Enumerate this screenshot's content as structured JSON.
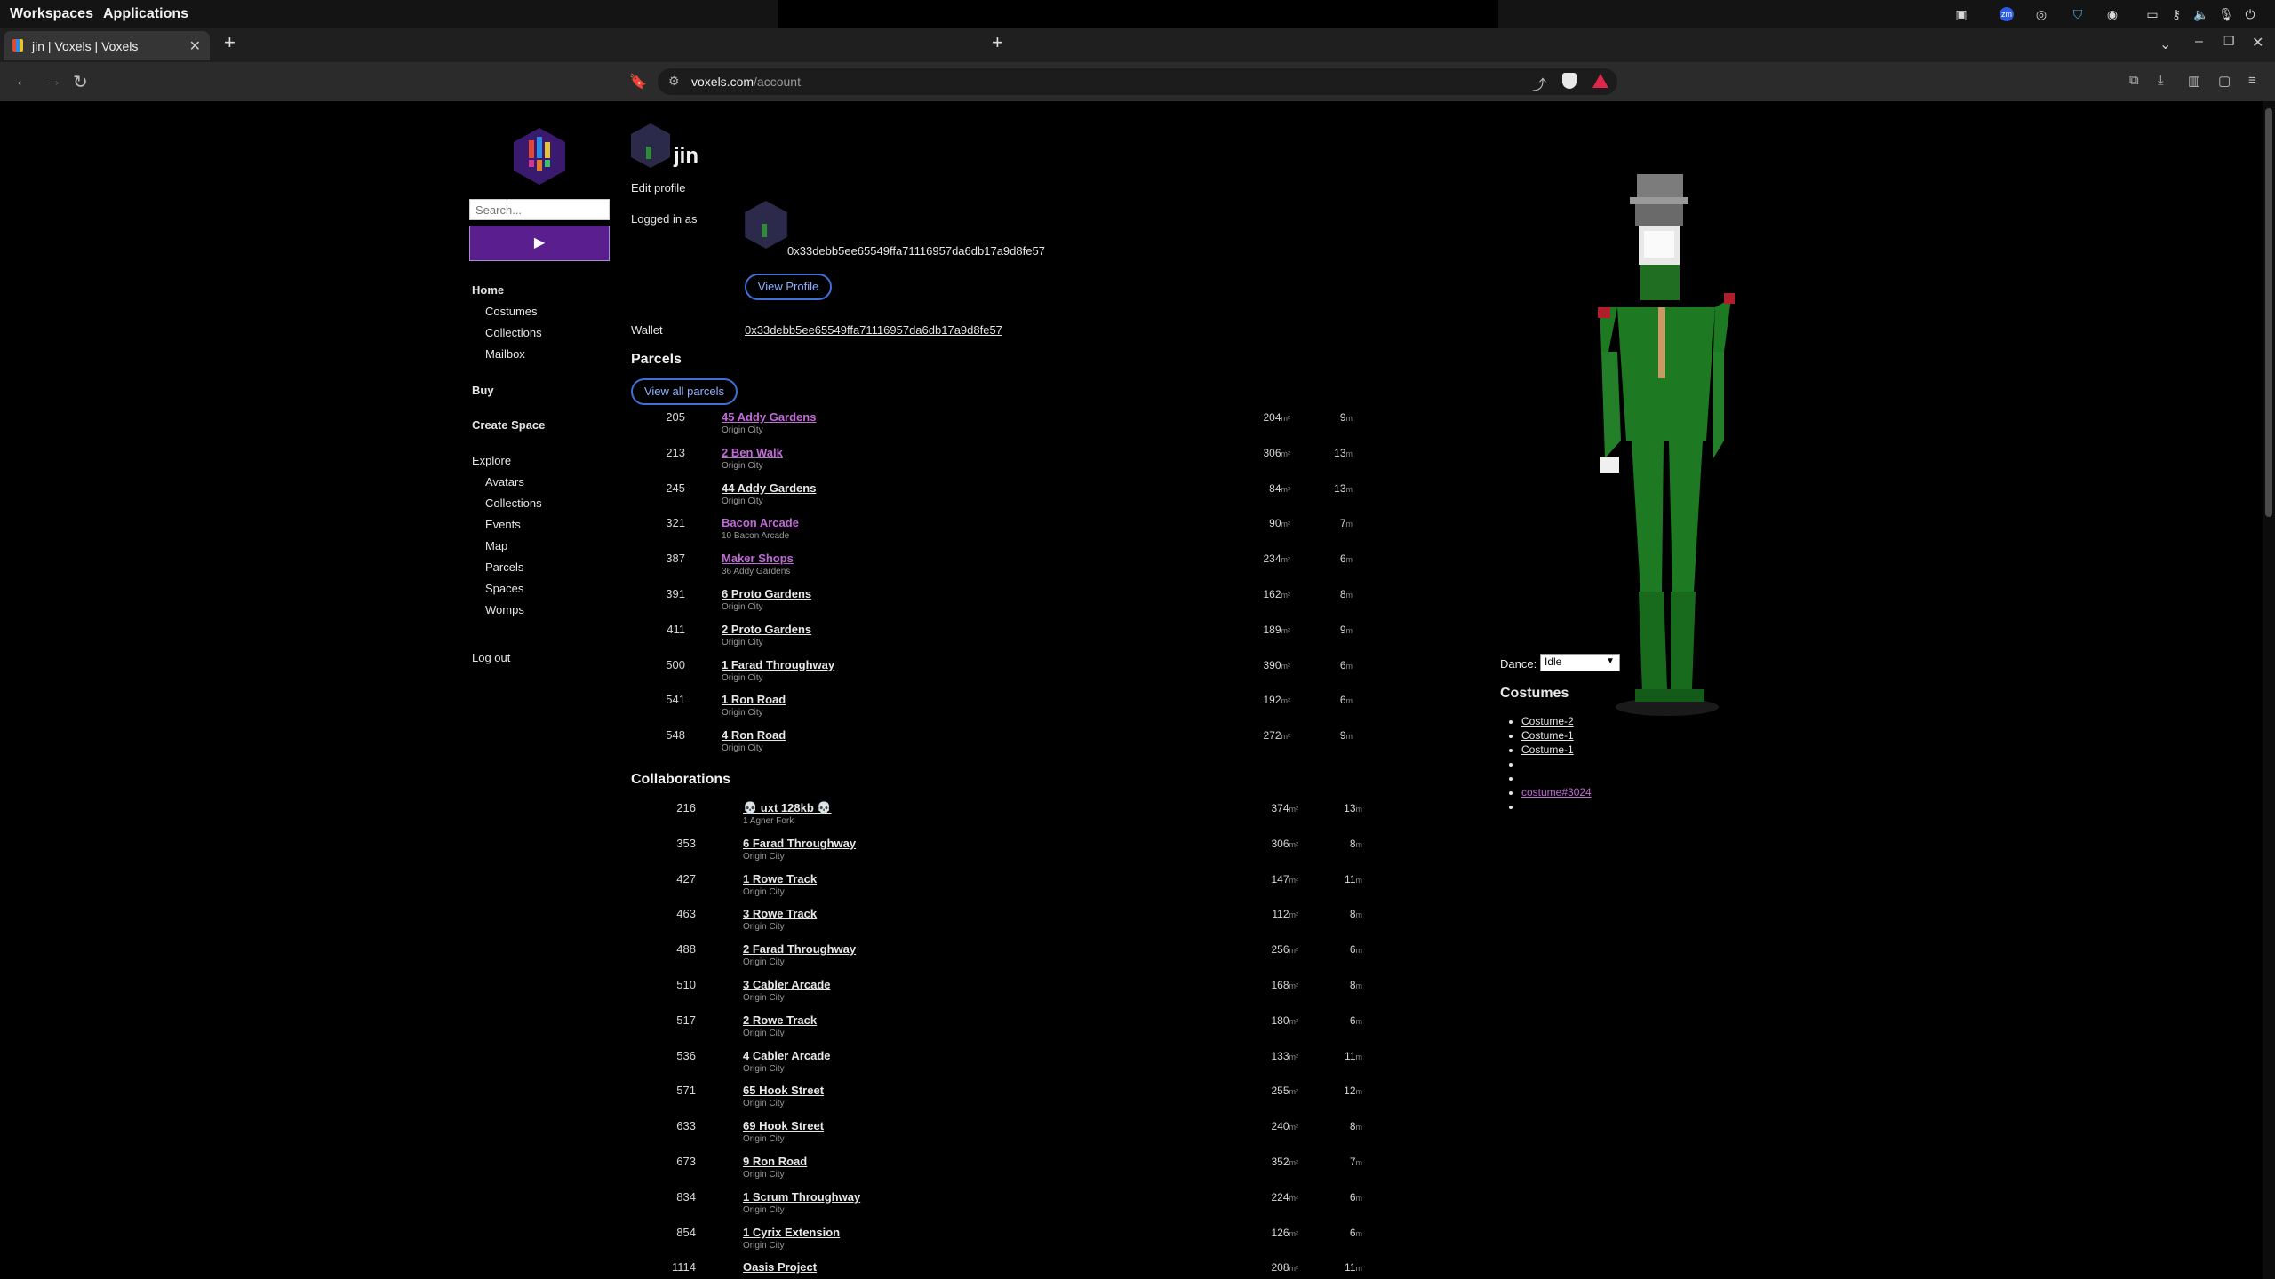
{
  "os_bar": {
    "workspaces": "Workspaces",
    "applications": "Applications",
    "tray_icons": [
      "dropbox-icon",
      "zoom-icon",
      "steam-icon",
      "vpn-icon",
      "discord-icon",
      "display-icon",
      "key-icon",
      "volume-icon",
      "mic-icon",
      "power-icon"
    ]
  },
  "browser": {
    "tab_title": "jin | Voxels | Voxels",
    "url_host": "voxels.com",
    "url_path": "/account"
  },
  "sidebar": {
    "search_placeholder": "Search...",
    "play_label": "▶",
    "home": "Home",
    "home_items": [
      "Costumes",
      "Collections",
      "Mailbox"
    ],
    "buy": "Buy",
    "create_space": "Create Space",
    "explore": "Explore",
    "explore_items": [
      "Avatars",
      "Collections",
      "Events",
      "Map",
      "Parcels",
      "Spaces",
      "Womps"
    ],
    "logout": "Log out"
  },
  "profile": {
    "name": "jin",
    "edit_profile": "Edit profile",
    "logged_in_as_label": "Logged in as",
    "address": "0x33debb5ee65549ffa71116957da6db17a9d8fe57",
    "view_profile": "View Profile",
    "wallet_label": "Wallet",
    "wallet_address": "0x33debb5ee65549ffa71116957da6db17a9d8fe57"
  },
  "parcels": {
    "heading": "Parcels",
    "view_all": "View all parcels",
    "area_unit": "m²",
    "height_unit": "m",
    "rows": [
      {
        "id": "205",
        "name": "45 Addy Gardens",
        "sub": "Origin City",
        "area": "204",
        "height": "9",
        "visited": true
      },
      {
        "id": "213",
        "name": "2 Ben Walk",
        "sub": "Origin City",
        "area": "306",
        "height": "13",
        "visited": true
      },
      {
        "id": "245",
        "name": "44 Addy Gardens",
        "sub": "Origin City",
        "area": "84",
        "height": "13",
        "visited": false
      },
      {
        "id": "321",
        "name": "Bacon Arcade",
        "sub": "10 Bacon Arcade",
        "area": "90",
        "height": "7",
        "visited": true
      },
      {
        "id": "387",
        "name": "Maker Shops",
        "sub": "36 Addy Gardens",
        "area": "234",
        "height": "6",
        "visited": true
      },
      {
        "id": "391",
        "name": "6 Proto Gardens",
        "sub": "Origin City",
        "area": "162",
        "height": "8",
        "visited": false
      },
      {
        "id": "411",
        "name": "2 Proto Gardens",
        "sub": "Origin City",
        "area": "189",
        "height": "9",
        "visited": false
      },
      {
        "id": "500",
        "name": "1 Farad Throughway",
        "sub": "Origin City",
        "area": "390",
        "height": "6",
        "visited": false
      },
      {
        "id": "541",
        "name": "1 Ron Road",
        "sub": "Origin City",
        "area": "192",
        "height": "6",
        "visited": false
      },
      {
        "id": "548",
        "name": "4 Ron Road",
        "sub": "Origin City",
        "area": "272",
        "height": "9",
        "visited": false
      }
    ]
  },
  "collaborations": {
    "heading": "Collaborations",
    "rows": [
      {
        "id": "216",
        "name": "💀 uxt 128kb 💀",
        "sub": "1 Agner Fork",
        "area": "374",
        "height": "13"
      },
      {
        "id": "353",
        "name": "6 Farad Throughway",
        "sub": "Origin City",
        "area": "306",
        "height": "8"
      },
      {
        "id": "427",
        "name": "1 Rowe Track",
        "sub": "Origin City",
        "area": "147",
        "height": "11"
      },
      {
        "id": "463",
        "name": "3 Rowe Track",
        "sub": "Origin City",
        "area": "112",
        "height": "8"
      },
      {
        "id": "488",
        "name": "2 Farad Throughway",
        "sub": "Origin City",
        "area": "256",
        "height": "6"
      },
      {
        "id": "510",
        "name": "3 Cabler Arcade",
        "sub": "Origin City",
        "area": "168",
        "height": "8"
      },
      {
        "id": "517",
        "name": "2 Rowe Track",
        "sub": "Origin City",
        "area": "180",
        "height": "6"
      },
      {
        "id": "536",
        "name": "4 Cabler Arcade",
        "sub": "Origin City",
        "area": "133",
        "height": "11"
      },
      {
        "id": "571",
        "name": "65 Hook Street",
        "sub": "Origin City",
        "area": "255",
        "height": "12"
      },
      {
        "id": "633",
        "name": "69 Hook Street",
        "sub": "Origin City",
        "area": "240",
        "height": "8"
      },
      {
        "id": "673",
        "name": "9 Ron Road",
        "sub": "Origin City",
        "area": "352",
        "height": "7"
      },
      {
        "id": "834",
        "name": "1 Scrum Throughway",
        "sub": "Origin City",
        "area": "224",
        "height": "6"
      },
      {
        "id": "854",
        "name": "1 Cyrix Extension",
        "sub": "Origin City",
        "area": "126",
        "height": "6"
      },
      {
        "id": "1114",
        "name": "Oasis Project",
        "sub": "",
        "area": "208",
        "height": "11"
      }
    ]
  },
  "avatar_panel": {
    "dance_label": "Dance:",
    "dance_value": "Idle",
    "costumes_heading": "Costumes",
    "costumes": [
      {
        "label": "Costume-2",
        "visited": false
      },
      {
        "label": "Costume-1",
        "visited": false
      },
      {
        "label": "Costume-1",
        "visited": false
      },
      {
        "label": "",
        "visited": false
      },
      {
        "label": "",
        "visited": false
      },
      {
        "label": "costume#3024",
        "visited": true
      },
      {
        "label": "",
        "visited": false
      }
    ]
  },
  "colors": {
    "accent_purple": "#5b1e8f",
    "visited_link": "#c06bd7",
    "pill_border": "#3f6fd9"
  }
}
